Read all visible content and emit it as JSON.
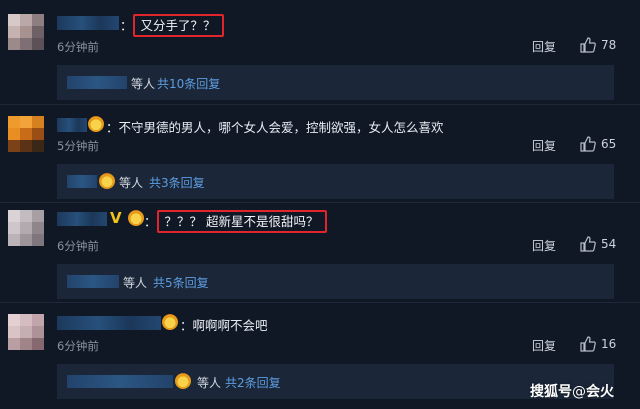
{
  "comments": [
    {
      "text": "又分手了？？",
      "time": "6分钟前",
      "reply_label": "回复",
      "likes": "78",
      "sub_replies": {
        "etc": "等人",
        "more": "共10条回复"
      },
      "avatar_colors": [
        "#d6c9c8",
        "#b9a8a7",
        "#8e7e81",
        "#c5b2b1",
        "#a8928f",
        "#6e6166",
        "#9c8a8b",
        "#7d6f73",
        "#5c5157"
      ]
    },
    {
      "text": "不守男德的男人，哪个女人会爱，控制欲强，女人怎么喜欢",
      "time": "5分钟前",
      "reply_label": "回复",
      "likes": "65",
      "sub_replies": {
        "etc": "等人",
        "more": "共3条回复"
      },
      "avatar_colors": [
        "#ef9a2d",
        "#f2a43a",
        "#d7801f",
        "#e88e22",
        "#c96c18",
        "#9b4d16",
        "#7a4216",
        "#5b3216",
        "#3a2716"
      ]
    },
    {
      "text": "？？？ 超新星不是很甜吗？",
      "time": "6分钟前",
      "reply_label": "回复",
      "likes": "54",
      "sub_replies": {
        "etc": "等人",
        "more": "共5条回复"
      },
      "avatar_colors": [
        "#d9d3d6",
        "#c2bbbf",
        "#a79fa4",
        "#cdc6ca",
        "#b3aab0",
        "#8f868c",
        "#bcb3b8",
        "#9e959b",
        "#7f777d"
      ]
    },
    {
      "text": "啊啊啊不会吧",
      "time": "6分钟前",
      "reply_label": "回复",
      "likes": "16",
      "sub_replies": {
        "etc": "等人",
        "more": "共2条回复"
      },
      "avatar_colors": [
        "#e4cfd2",
        "#d5bcc0",
        "#c1a5aa",
        "#d9c3c7",
        "#c7aeb3",
        "#ad9297",
        "#b99ea3",
        "#a08488",
        "#85696e"
      ]
    }
  ],
  "watermark": {
    "brand": "搜狐号",
    "at": "@",
    "author": "会火"
  },
  "colors": {
    "background": "#101826",
    "sub_panel": "#1b2739",
    "highlight_border": "#e0252c",
    "link": "#5d9de0"
  },
  "icons": {
    "like": "thumbs-up-icon",
    "badge": "crown-badge-icon",
    "verified": "v-verified-icon"
  }
}
